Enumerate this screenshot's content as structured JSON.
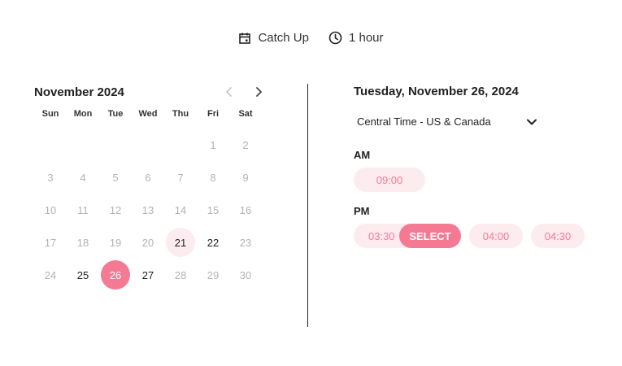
{
  "event": {
    "name": "Catch Up",
    "duration": "1 hour",
    "name_icon": "calendar-icon",
    "duration_icon": "clock-icon"
  },
  "calendar": {
    "month_title": "November 2024",
    "prev_icon": "chevron-left-icon",
    "next_icon": "chevron-right-icon",
    "weekdays": [
      "Sun",
      "Mon",
      "Tue",
      "Wed",
      "Thu",
      "Fri",
      "Sat"
    ],
    "weeks": [
      [
        "",
        "",
        "",
        "",
        "",
        "1",
        "2"
      ],
      [
        "3",
        "4",
        "5",
        "6",
        "7",
        "8",
        "9"
      ],
      [
        "10",
        "11",
        "12",
        "13",
        "14",
        "15",
        "16"
      ],
      [
        "17",
        "18",
        "19",
        "20",
        "21",
        "22",
        "23"
      ],
      [
        "24",
        "25",
        "26",
        "27",
        "28",
        "29",
        "30"
      ]
    ],
    "available_days": [
      "21",
      "22",
      "25",
      "26",
      "27"
    ],
    "today": "21",
    "selected": "26"
  },
  "panel": {
    "date_title": "Tuesday, November 26, 2024",
    "timezone": "Central Time - US & Canada",
    "am_label": "AM",
    "pm_label": "PM",
    "am_slots": [
      "09:00"
    ],
    "pm_slots": [
      "03:30",
      "04:00",
      "04:30"
    ],
    "select_label": "SELECT"
  },
  "colors": {
    "accent": "#f47a94",
    "accent_light": "#fdecef",
    "disabled_text": "#b3b3b3"
  }
}
